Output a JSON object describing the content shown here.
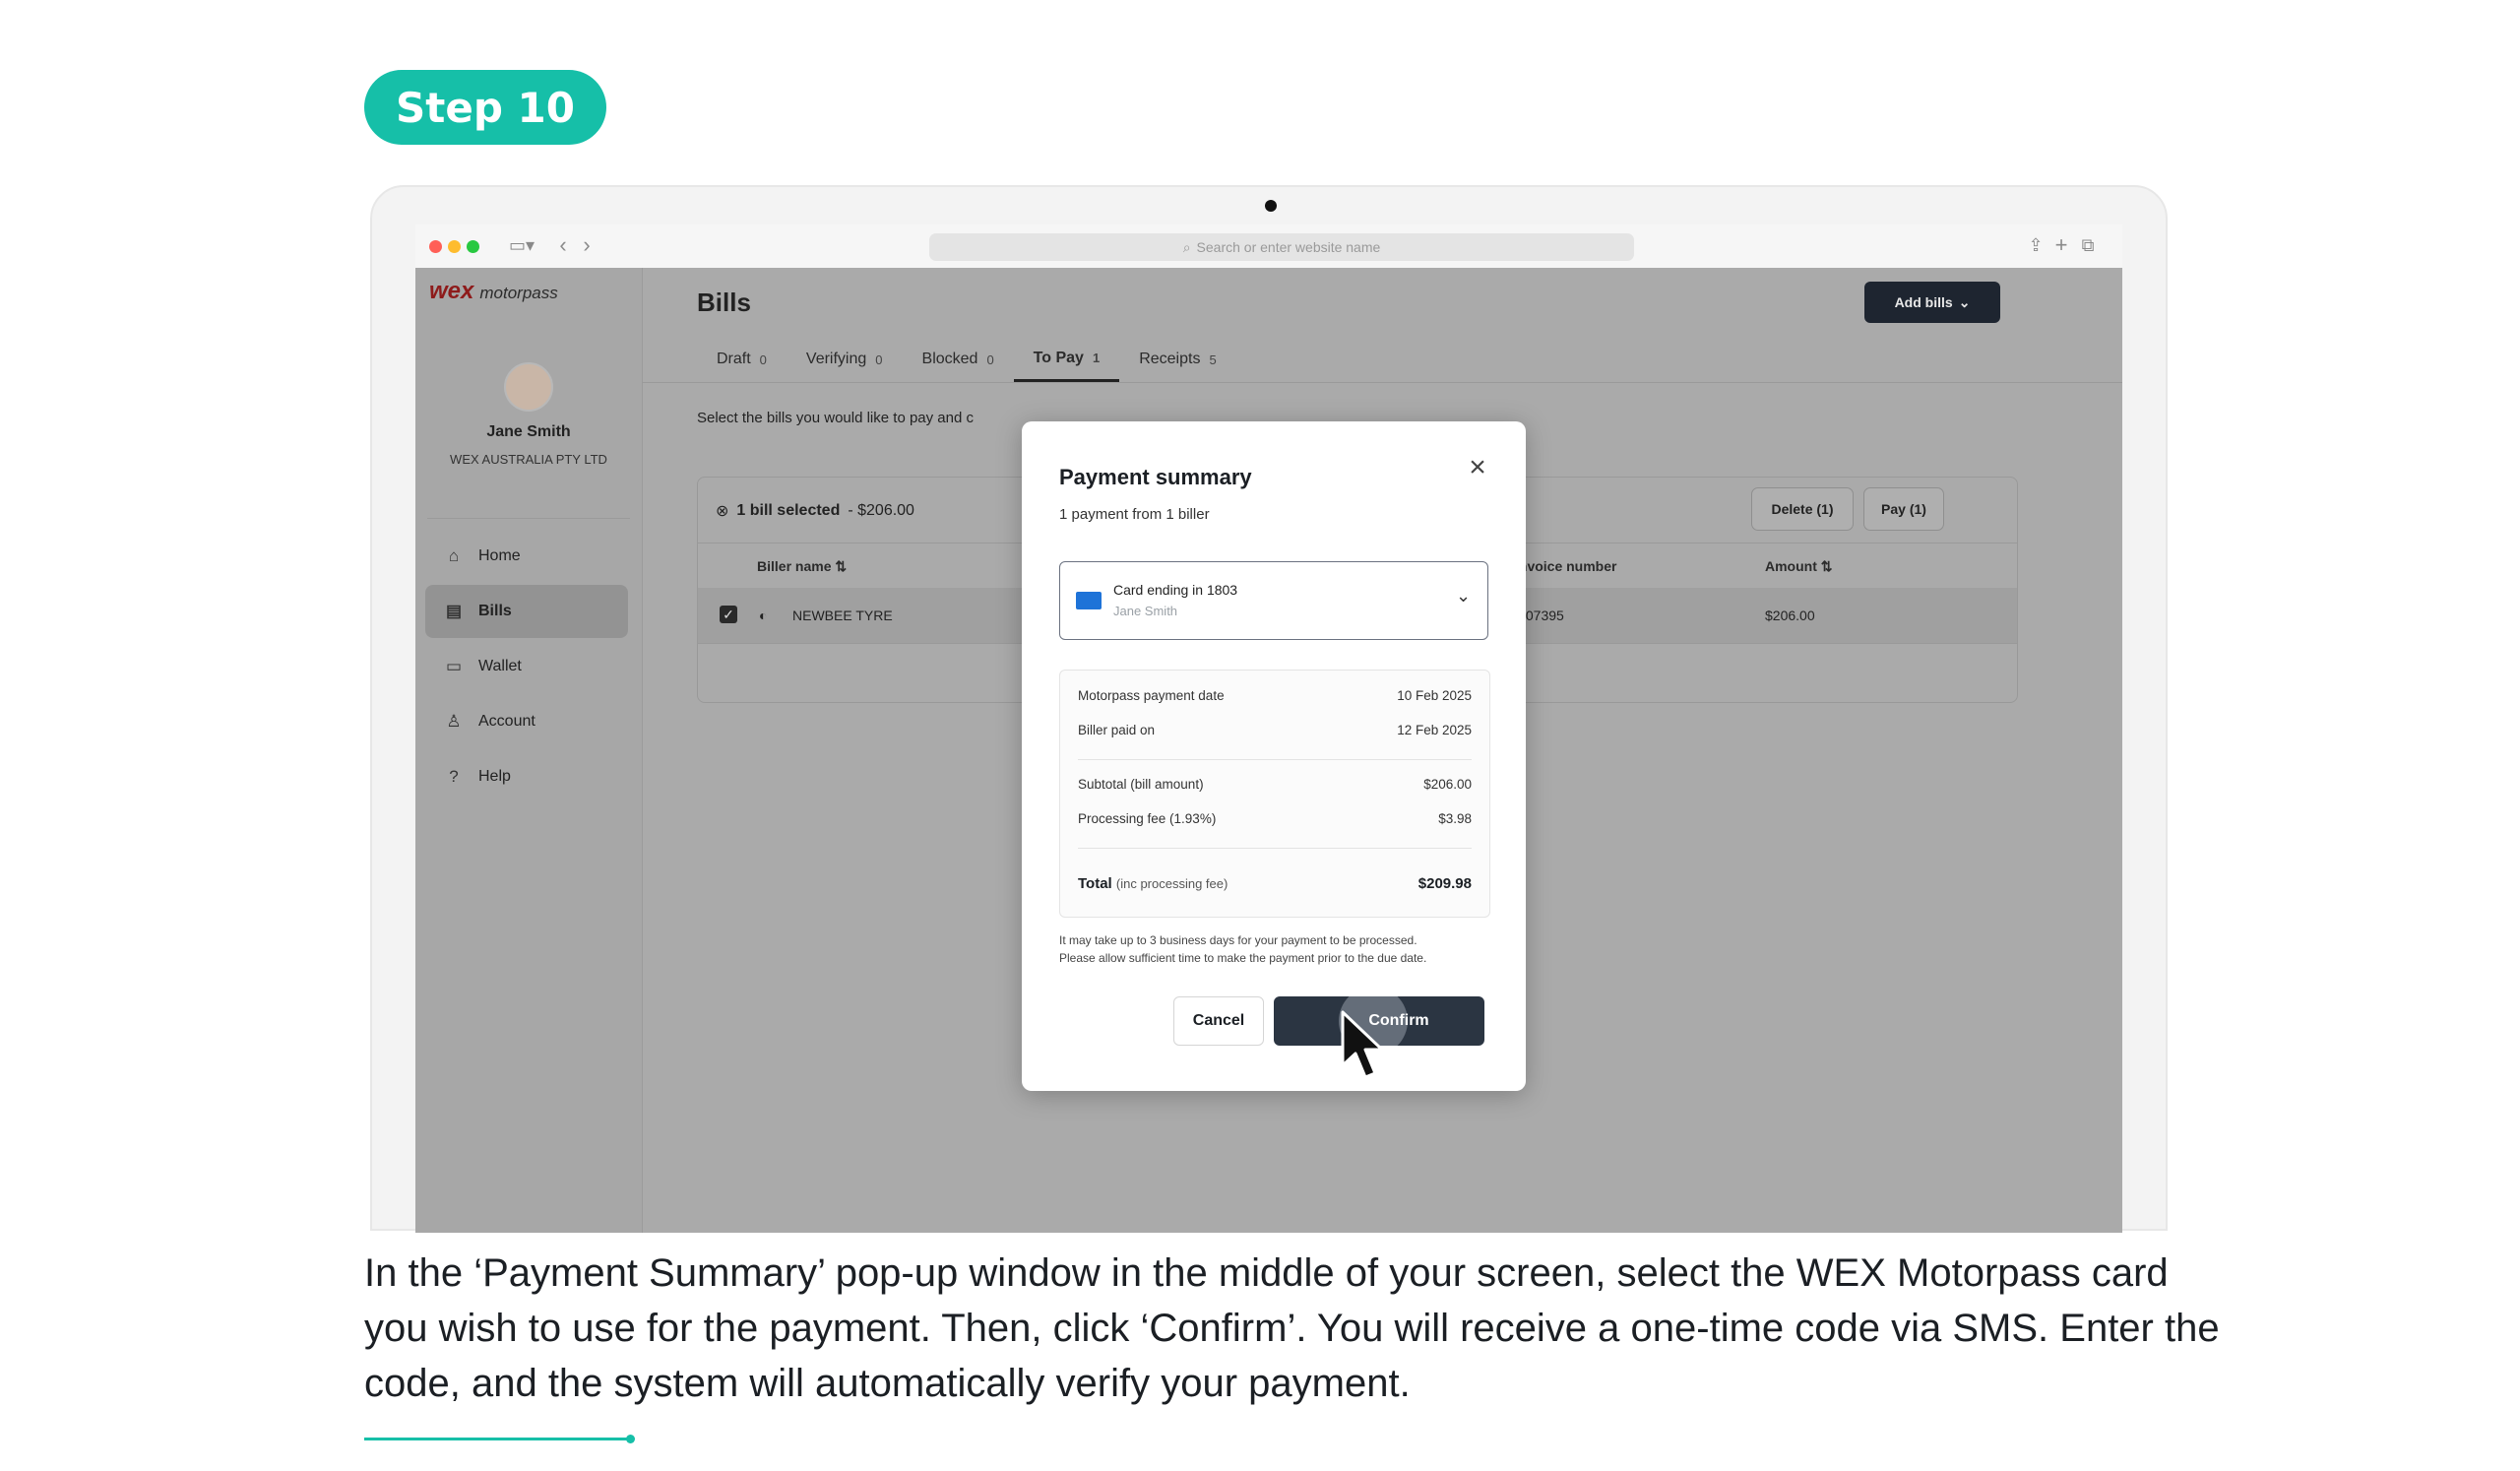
{
  "step_label": "Step 10",
  "browser": {
    "address_placeholder": "Search or enter website name"
  },
  "app": {
    "logo_brand": "wex",
    "logo_product": "motorpass",
    "user": {
      "name": "Jane Smith",
      "company": "WEX AUSTRALIA PTY LTD"
    },
    "nav": [
      {
        "label": "Home",
        "icon": "home-icon"
      },
      {
        "label": "Bills",
        "icon": "document-icon",
        "active": true
      },
      {
        "label": "Wallet",
        "icon": "wallet-icon"
      },
      {
        "label": "Account",
        "icon": "person-icon"
      },
      {
        "label": "Help",
        "icon": "help-icon"
      }
    ],
    "page_title": "Bills",
    "add_bills_label": "Add bills",
    "tabs": [
      {
        "label": "Draft",
        "count": "0"
      },
      {
        "label": "Verifying",
        "count": "0"
      },
      {
        "label": "Blocked",
        "count": "0"
      },
      {
        "label": "To Pay",
        "count": "1",
        "active": true
      },
      {
        "label": "Receipts",
        "count": "5"
      }
    ],
    "instruction": "Select the bills you would like to pay and c",
    "selection": {
      "count_text": "1 bill selected",
      "amount_text": " - $206.00"
    },
    "delete_label": "Delete (1)",
    "pay_label": "Pay (1)",
    "table": {
      "headers": {
        "biller": "Biller name",
        "invoice": "Invoice number",
        "amount": "Amount"
      },
      "rows": [
        {
          "biller": "NEWBEE TYRE",
          "invoice": "Q07395",
          "amount": "$206.00"
        }
      ]
    }
  },
  "modal": {
    "title": "Payment summary",
    "subtitle": "1 payment from 1 biller",
    "card_label": "Card ending in 1803",
    "card_holder": "Jane Smith",
    "rows": [
      {
        "label": "Motorpass payment date",
        "value": "10 Feb 2025"
      },
      {
        "label": "Biller paid on",
        "value": "12 Feb 2025"
      },
      {
        "label": "Subtotal (bill amount)",
        "value": "$206.00"
      },
      {
        "label": "Processing fee (1.93%)",
        "value": "$3.98"
      }
    ],
    "total_label": "Total",
    "total_note": "(inc processing fee)",
    "total_value": "$209.98",
    "notice_line1": "It may take up to 3 business days for your payment to be processed.",
    "notice_line2": "Please allow sufficient time to make the payment prior to the due date.",
    "cancel_label": "Cancel",
    "confirm_label": "Confirm"
  },
  "caption": " In the ‘Payment Summary’ pop-up window in the middle of your screen, select the WEX Motorpass card you wish to use for the payment. Then, click ‘Confirm’. You will receive a one-time code via SMS. Enter the code, and the system will automatically verify your payment.",
  "colors": {
    "accent": "#16bfa8",
    "dark_button": "#2b3542",
    "card_icon": "#1e73d8"
  }
}
